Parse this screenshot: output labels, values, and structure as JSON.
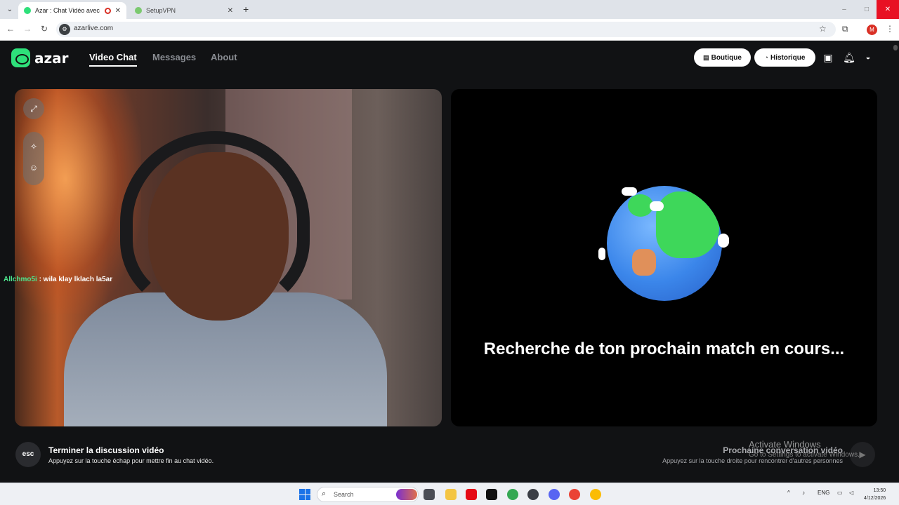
{
  "browser": {
    "tabs": [
      {
        "title": "Azar : Chat Vidéo avec de n",
        "active": true
      },
      {
        "title": "SetupVPN",
        "active": false
      }
    ],
    "url": "azarlive.com",
    "profile_initial": "M"
  },
  "header": {
    "logo": "azar",
    "nav": [
      {
        "label": "Video Chat",
        "active": true
      },
      {
        "label": "Messages",
        "active": false
      },
      {
        "label": "About",
        "active": false
      }
    ],
    "boutique": "Boutique",
    "historique": "Historique",
    "icons": [
      "store-icon",
      "bell-icon",
      "avatar-icon"
    ]
  },
  "video": {
    "chat_username": "Allchmo5i",
    "chat_message": " : wila klay lklach la5ar",
    "tools": [
      "fullscreen-icon",
      "magic-wand-icon",
      "emoji-icon"
    ]
  },
  "match": {
    "searching_text": "Recherche de ton prochain match en cours..."
  },
  "footer": {
    "esc_key": "esc",
    "end_title": "Terminer la discussion vidéo",
    "end_hint": "Appuyez sur la touche échap pour mettre fin au chat vidéo.",
    "next_title": "Prochaine conversation vidéo",
    "next_hint": "Appuyez sur la touche droite pour rencontrer d'autres personnes"
  },
  "os": {
    "watermark_title": "Activate Windows",
    "watermark_sub": "Go to Settings to activate Windows.",
    "search_placeholder": "Search",
    "lang": "ENG",
    "time": "13:50",
    "date": "4/12/2026"
  },
  "colors": {
    "accent_green": "#2ee07a",
    "background": "#111214",
    "close_red": "#e81123"
  }
}
